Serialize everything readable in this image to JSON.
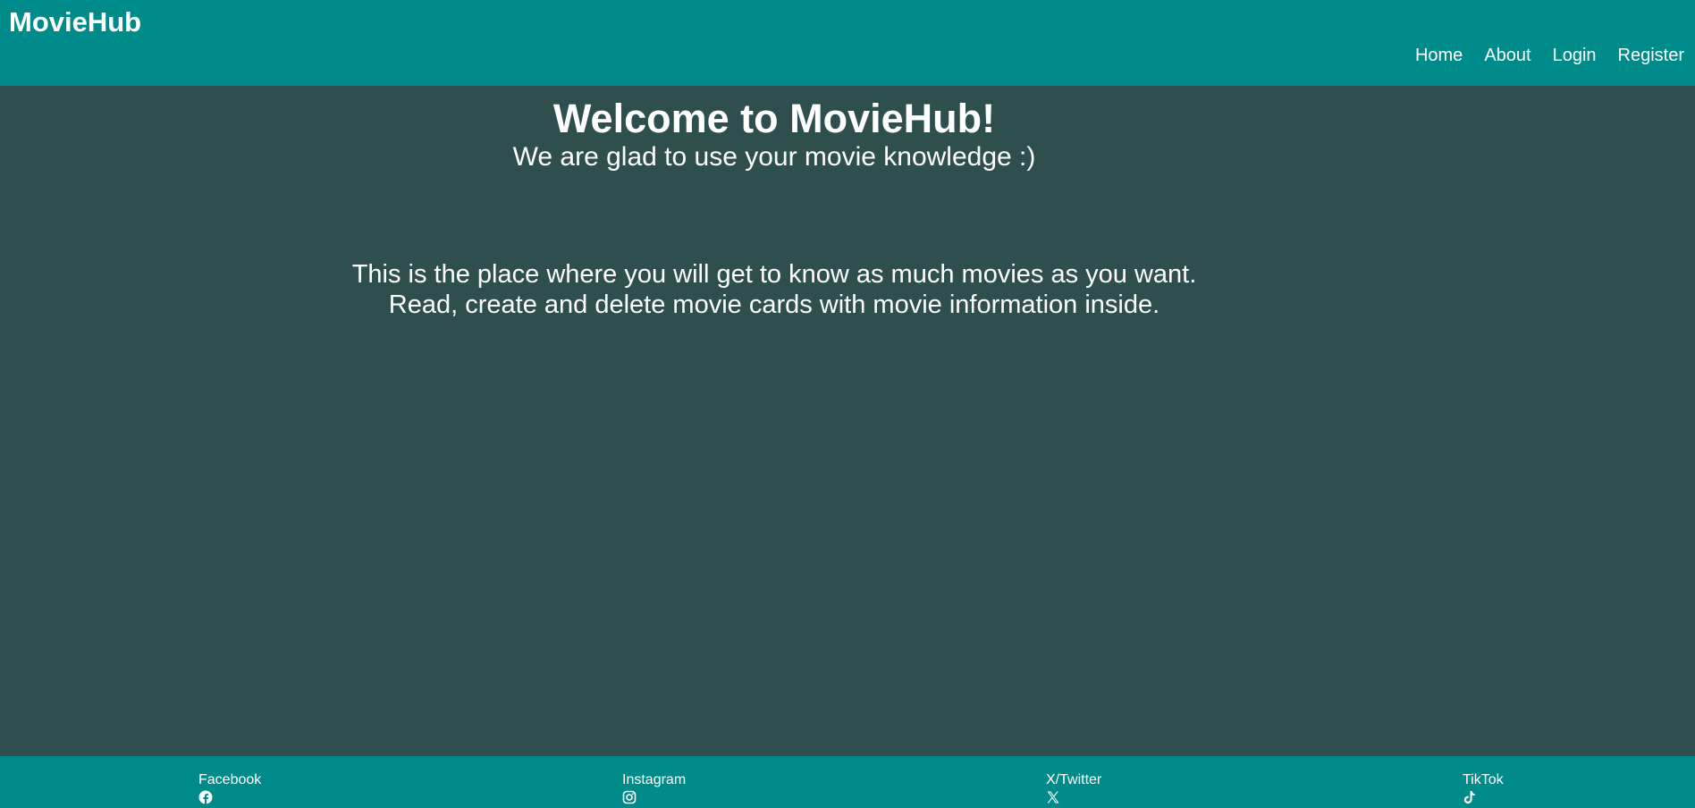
{
  "header": {
    "brand": "MovieHub",
    "nav": {
      "home": "Home",
      "about": "About",
      "login": "Login",
      "register": "Register"
    }
  },
  "main": {
    "title": "Welcome to MovieHub!",
    "subtitle": "We are glad to use your movie knowledge :)",
    "description_line_1": "This is the place where you will get to know as much movies as you want.",
    "description_line_2": "Read, create and delete movie cards with movie information inside."
  },
  "footer": {
    "socials": {
      "facebook": {
        "label": "Facebook",
        "icon": "facebook-icon"
      },
      "instagram": {
        "label": "Instagram",
        "icon": "instagram-icon"
      },
      "twitter": {
        "label": "X/Twitter",
        "icon": "x-icon"
      },
      "tiktok": {
        "label": "TikTok",
        "icon": "tiktok-icon"
      }
    }
  },
  "colors": {
    "header_bg": "#008b8b",
    "main_bg": "#2f4f4f",
    "footer_bg": "#008b8b",
    "text": "#ffffff"
  }
}
